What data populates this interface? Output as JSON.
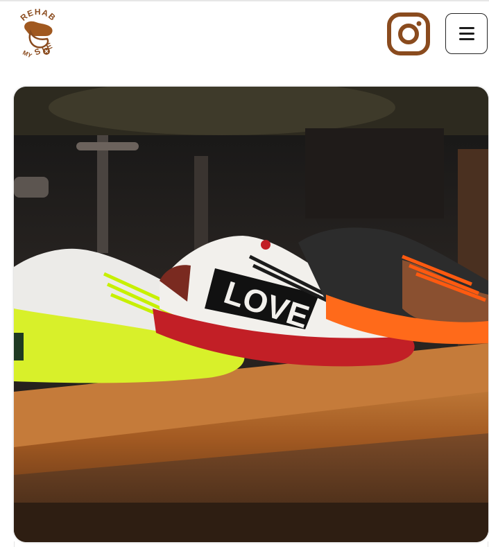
{
  "brand": {
    "logo_top_text": "REHAB",
    "logo_bottom_left": "MY",
    "logo_bottom_right": "S LE",
    "accent_color": "#8a4b1e"
  },
  "header": {
    "instagram_icon": "instagram-icon",
    "menu_icon": "hamburger-menu-icon"
  },
  "hero": {
    "image_name": "sneakers-display-photo",
    "shoe_text": "LOVE",
    "colors": {
      "sole_yellow": "#d8f02a",
      "sole_red": "#c21f26",
      "sole_orange": "#ff6a1a"
    }
  }
}
